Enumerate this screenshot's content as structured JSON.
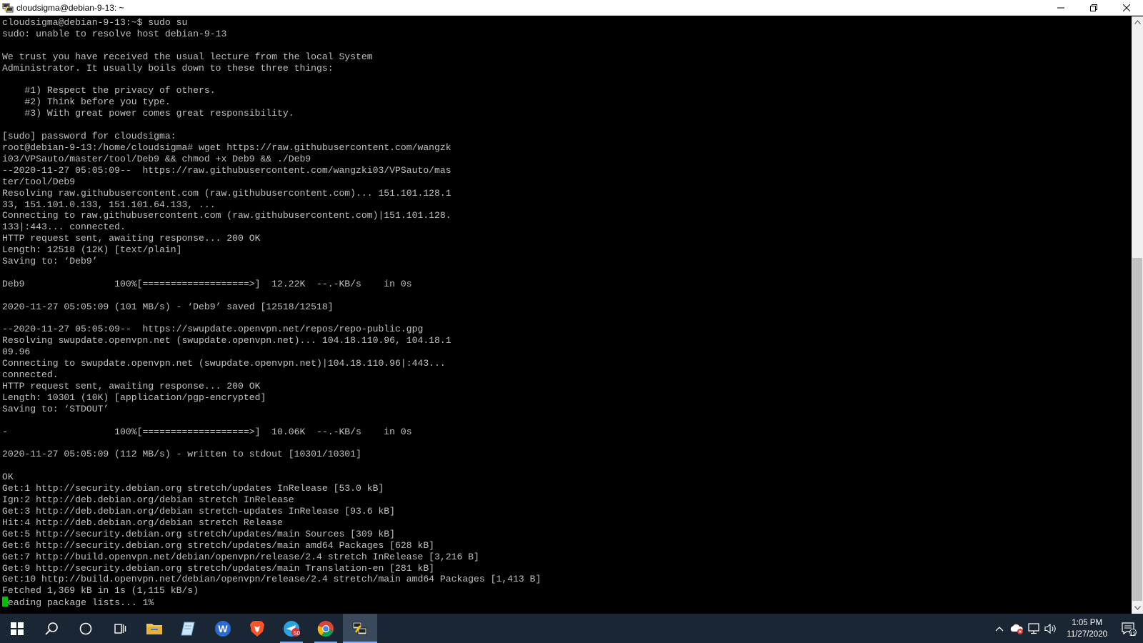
{
  "window": {
    "title": "cloudsigma@debian-9-13: ~",
    "icon": "putty-icon",
    "controls": [
      "minimize-icon",
      "restore-icon",
      "close-icon"
    ]
  },
  "terminal": {
    "lines": [
      "cloudsigma@debian-9-13:~$ sudo su",
      "sudo: unable to resolve host debian-9-13",
      "",
      "We trust you have received the usual lecture from the local System",
      "Administrator. It usually boils down to these three things:",
      "",
      "    #1) Respect the privacy of others.",
      "    #2) Think before you type.",
      "    #3) With great power comes great responsibility.",
      "",
      "[sudo] password for cloudsigma:",
      "root@debian-9-13:/home/cloudsigma# wget https://raw.githubusercontent.com/wangzk",
      "i03/VPSauto/master/tool/Deb9 && chmod +x Deb9 && ./Deb9",
      "--2020-11-27 05:05:09--  https://raw.githubusercontent.com/wangzki03/VPSauto/mas",
      "ter/tool/Deb9",
      "Resolving raw.githubusercontent.com (raw.githubusercontent.com)... 151.101.128.1",
      "33, 151.101.0.133, 151.101.64.133, ...",
      "Connecting to raw.githubusercontent.com (raw.githubusercontent.com)|151.101.128.",
      "133|:443... connected.",
      "HTTP request sent, awaiting response... 200 OK",
      "Length: 12518 (12K) [text/plain]",
      "Saving to: ‘Deb9’",
      "",
      "Deb9                100%[===================>]  12.22K  --.-KB/s    in 0s",
      "",
      "2020-11-27 05:05:09 (101 MB/s) - ‘Deb9’ saved [12518/12518]",
      "",
      "--2020-11-27 05:05:09--  https://swupdate.openvpn.net/repos/repo-public.gpg",
      "Resolving swupdate.openvpn.net (swupdate.openvpn.net)... 104.18.110.96, 104.18.1",
      "09.96",
      "Connecting to swupdate.openvpn.net (swupdate.openvpn.net)|104.18.110.96|:443...",
      "connected.",
      "HTTP request sent, awaiting response... 200 OK",
      "Length: 10301 (10K) [application/pgp-encrypted]",
      "Saving to: ‘STDOUT’",
      "",
      "-                   100%[===================>]  10.06K  --.-KB/s    in 0s",
      "",
      "2020-11-27 05:05:09 (112 MB/s) - written to stdout [10301/10301]",
      "",
      "OK",
      "Get:1 http://security.debian.org stretch/updates InRelease [53.0 kB]",
      "Ign:2 http://deb.debian.org/debian stretch InRelease",
      "Get:3 http://deb.debian.org/debian stretch-updates InRelease [93.6 kB]",
      "Hit:4 http://deb.debian.org/debian stretch Release",
      "Get:5 http://security.debian.org stretch/updates/main Sources [309 kB]",
      "Get:6 http://security.debian.org stretch/updates/main amd64 Packages [628 kB]",
      "Get:7 http://build.openvpn.net/debian/openvpn/release/2.4 stretch InRelease [3,216 B]",
      "Get:9 http://security.debian.org stretch/updates/main Translation-en [281 kB]",
      "Get:10 http://build.openvpn.net/debian/openvpn/release/2.4 stretch/main amd64 Packages [1,413 B]",
      "Fetched 1,369 kB in 1s (1,115 kB/s)"
    ],
    "last_line_rest": "eading package lists... 1%"
  },
  "taskbar": {
    "items": [
      {
        "name": "start-icon",
        "active": false
      },
      {
        "name": "search-icon",
        "active": false
      },
      {
        "name": "cortana-icon",
        "active": false
      },
      {
        "name": "task-view-icon",
        "active": false
      },
      {
        "name": "file-explorer-icon",
        "active": false
      },
      {
        "name": "notepad-icon",
        "active": false
      },
      {
        "name": "word-icon",
        "active": false
      },
      {
        "name": "brave-icon",
        "active": false
      },
      {
        "name": "telegram-icon",
        "active": false
      },
      {
        "name": "chrome-icon",
        "active": false
      },
      {
        "name": "putty-icon",
        "active": true
      }
    ],
    "telegram_badge": "50",
    "clock": {
      "time": "1:05 PM",
      "date": "11/27/2020"
    },
    "notification_count": "12"
  },
  "colors": {
    "terminal_bg": "#000000",
    "terminal_fg": "#c0c0c0",
    "cursor": "#00c000",
    "taskbar_bg": "#1a2633"
  }
}
